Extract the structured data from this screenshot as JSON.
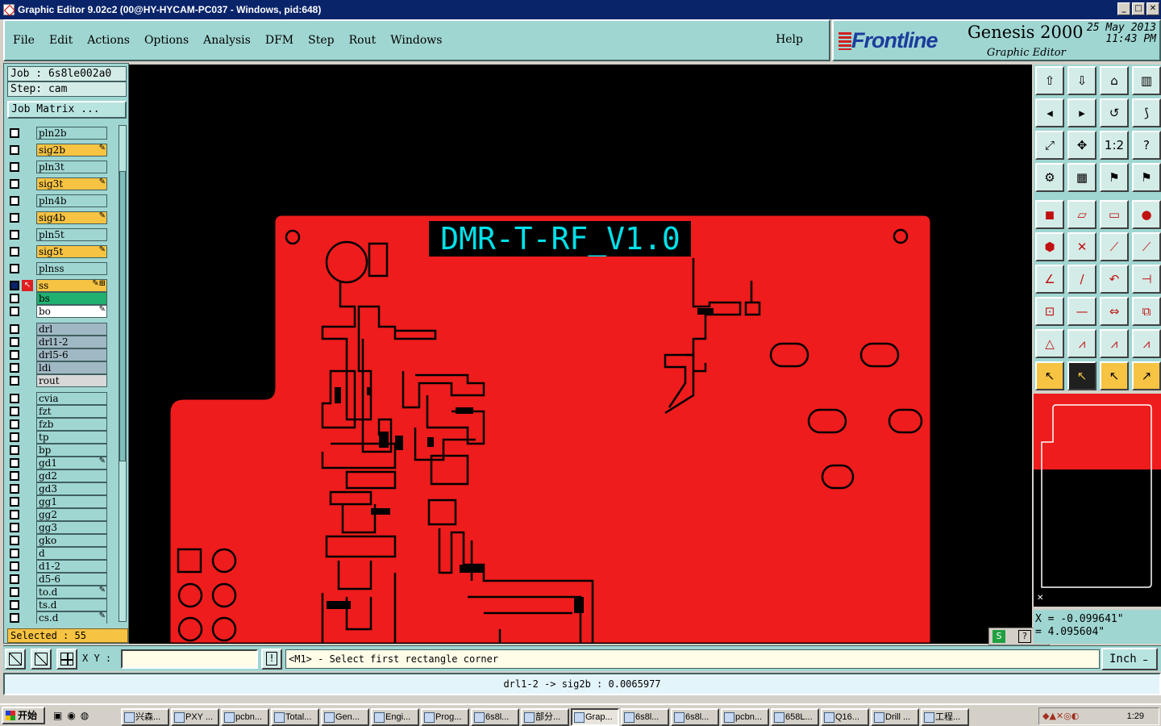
{
  "window": {
    "title": "Graphic Editor 9.02c2 (00@HY-HYCAM-PC037 - Windows, pid:648)"
  },
  "menu": {
    "items": [
      {
        "label": "File"
      },
      {
        "label": "Edit"
      },
      {
        "label": "Actions"
      },
      {
        "label": "Options"
      },
      {
        "label": "Analysis"
      },
      {
        "label": "DFM"
      },
      {
        "label": "Step"
      },
      {
        "label": "Rout"
      },
      {
        "label": "Windows"
      }
    ],
    "help": "Help"
  },
  "logo": {
    "brand": "Frontline",
    "product": "Genesis 2000",
    "subtitle": "Graphic Editor",
    "date": "25 May 2013",
    "time": "11:43 PM"
  },
  "job": {
    "job_line": "Job : 6s8le002a0",
    "step_line": "Step: cam",
    "matrix_button": "Job Matrix ..."
  },
  "layers": [
    {
      "name": "pln2b",
      "color": "#9fd6d2",
      "flag": ""
    },
    {
      "name": "sig2b",
      "color": "#f6c343",
      "flag": "✎"
    },
    {
      "name": "pln3t",
      "color": "#9fd6d2",
      "flag": ""
    },
    {
      "name": "sig3t",
      "color": "#f6c343",
      "flag": "✎"
    },
    {
      "name": "pln4b",
      "color": "#9fd6d2",
      "flag": ""
    },
    {
      "name": "sig4b",
      "color": "#f6c343",
      "flag": "✎"
    },
    {
      "name": "pln5t",
      "color": "#9fd6d2",
      "flag": ""
    },
    {
      "name": "sig5t",
      "color": "#f6c343",
      "flag": "✎"
    },
    {
      "name": "plnss",
      "color": "#9fd6d2",
      "flag": ""
    },
    {
      "name": "ss",
      "color": "#f6c343",
      "flag": "✎⊞"
    },
    {
      "name": "bs",
      "color": "#20b070",
      "flag": ""
    },
    {
      "name": "bo",
      "color": "#ffffff",
      "flag": "✎"
    },
    {
      "name": "drl",
      "color": "#a0b8c4",
      "flag": ""
    },
    {
      "name": "drl1-2",
      "color": "#a0b8c4",
      "flag": ""
    },
    {
      "name": "drl5-6",
      "color": "#a0b8c4",
      "flag": ""
    },
    {
      "name": "ldi",
      "color": "#a0b8c4",
      "flag": ""
    },
    {
      "name": "rout",
      "color": "#d8d8d8",
      "flag": ""
    },
    {
      "name": "cvia",
      "color": "#9fd6d2",
      "flag": ""
    },
    {
      "name": "fzt",
      "color": "#9fd6d2",
      "flag": ""
    },
    {
      "name": "fzb",
      "color": "#9fd6d2",
      "flag": ""
    },
    {
      "name": "tp",
      "color": "#9fd6d2",
      "flag": ""
    },
    {
      "name": "bp",
      "color": "#9fd6d2",
      "flag": ""
    },
    {
      "name": "gd1",
      "color": "#9fd6d2",
      "flag": "✎"
    },
    {
      "name": "gd2",
      "color": "#9fd6d2",
      "flag": ""
    },
    {
      "name": "gd3",
      "color": "#9fd6d2",
      "flag": ""
    },
    {
      "name": "gg1",
      "color": "#9fd6d2",
      "flag": ""
    },
    {
      "name": "gg2",
      "color": "#9fd6d2",
      "flag": ""
    },
    {
      "name": "gg3",
      "color": "#9fd6d2",
      "flag": ""
    },
    {
      "name": "gko",
      "color": "#9fd6d2",
      "flag": ""
    },
    {
      "name": "d",
      "color": "#9fd6d2",
      "flag": ""
    },
    {
      "name": "d1-2",
      "color": "#9fd6d2",
      "flag": ""
    },
    {
      "name": "d5-6",
      "color": "#9fd6d2",
      "flag": ""
    },
    {
      "name": "to.d",
      "color": "#9fd6d2",
      "flag": "✎"
    },
    {
      "name": "ts.d",
      "color": "#9fd6d2",
      "flag": ""
    },
    {
      "name": "cs.d",
      "color": "#9fd6d2",
      "flag": "✎"
    }
  ],
  "selected_text": "Selected : 55",
  "board": {
    "label": "DMR-T-RF_V1.0",
    "fill": "#ee1c1c",
    "label_color": "#00e0e8"
  },
  "coords": {
    "x": "X = -0.099641\"",
    "y": "= 4.095604\""
  },
  "cmd": {
    "xy_label": "X Y :",
    "prompt": "<M1> - Select first rectangle corner",
    "units": "Inch"
  },
  "status": "drl1-2 -> sig2b : 0.0065977",
  "taskbar": {
    "start": "开始",
    "tasks": [
      "兴森...",
      "PXY ...",
      "pcbn...",
      "Total...",
      "Gen...",
      "Engi...",
      "Prog...",
      "6s8l...",
      "部分...",
      "Grap...",
      "6s8l...",
      "6s8l...",
      "pcbn...",
      "658L...",
      "Q16...",
      "Drill ...",
      "工程..."
    ],
    "clock": "1:29"
  }
}
